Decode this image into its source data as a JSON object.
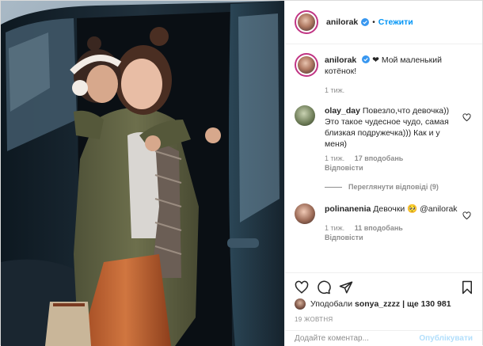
{
  "post": {
    "username": "anilorak",
    "follow_label": "Стежити",
    "dot": "•"
  },
  "caption": {
    "username": "anilorak",
    "text": "❤ Мой маленький котёнок!",
    "time": "1 тиж."
  },
  "comments": [
    {
      "username": "olay_day",
      "text": "Повезло,что девочка)) Это такое чудесное чудо, самая близкая подружечка))) Как и у меня)",
      "time": "1 тиж.",
      "likes": "17 вподобань",
      "reply": "Відповісти",
      "view_replies": "Переглянути відповіді (9)"
    },
    {
      "username": "polinanenia",
      "text": "Девочки 🥺 @anilorak",
      "time": "1 тиж.",
      "likes": "11 вподобань",
      "reply": "Відповісти"
    }
  ],
  "likes": {
    "prefix": "Уподобали",
    "user": "sonya_zzzz",
    "suffix": "| ще 130 981"
  },
  "date": "19 ЖОВТНЯ",
  "add_comment": {
    "placeholder": "Додайте коментар...",
    "publish": "Опублікувати"
  },
  "colors": {
    "link": "#0095f6",
    "muted": "#8e8e8e",
    "publish_disabled": "#b2dffc"
  },
  "icons": [
    "verified-icon",
    "heart-icon",
    "comment-icon",
    "share-icon",
    "bookmark-icon"
  ]
}
